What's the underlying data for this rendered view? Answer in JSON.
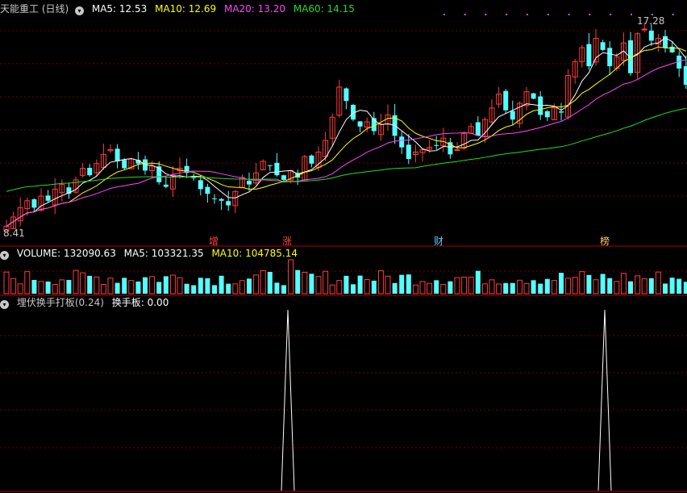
{
  "main": {
    "title": "天能重工 (日线)",
    "ma5": "MA5: 12.53",
    "ma10": "MA10: 12.69",
    "ma20": "MA20: 13.20",
    "ma60": "MA60: 14.15",
    "high_label": "17.28",
    "low_label": "8.41",
    "markers": [
      "增",
      "涨",
      "财",
      "榜"
    ]
  },
  "volume": {
    "label": "VOLUME: 132090.63",
    "ma5": "MA5: 103321.35",
    "ma10": "MA10: 104785.14"
  },
  "indicator": {
    "name": "埋伏换手打板(0.24)",
    "value": "换手板: 0.00"
  },
  "chart_data": {
    "type": "candlestick",
    "title": "天能重工 (日线)",
    "price_range": [
      8.41,
      17.28
    ],
    "close": [
      8.5,
      8.9,
      9.3,
      9.6,
      9.3,
      9.8,
      9.6,
      10.1,
      10.3,
      9.9,
      10.5,
      11.0,
      10.7,
      11.2,
      11.6,
      11.8,
      11.3,
      11.0,
      11.4,
      11.2,
      10.9,
      11.1,
      10.4,
      10.2,
      10.7,
      11.0,
      10.8,
      10.6,
      10.1,
      9.9,
      9.7,
      9.6,
      9.4,
      10.0,
      10.6,
      10.3,
      10.8,
      11.3,
      11.1,
      10.7,
      10.5,
      10.9,
      10.6,
      11.5,
      11.2,
      11.7,
      12.2,
      13.2,
      14.5,
      13.9,
      13.1,
      12.8,
      13.0,
      12.6,
      12.9,
      13.3,
      12.4,
      11.9,
      11.4,
      11.7,
      11.8,
      11.9,
      12.0,
      12.3,
      11.6,
      11.8,
      12.5,
      12.8,
      12.4,
      13.1,
      13.6,
      14.2,
      13.5,
      13.1,
      13.8,
      14.3,
      14.0,
      13.3,
      13.2,
      13.6,
      13.4,
      15.0,
      15.6,
      16.2,
      15.4,
      16.6,
      16.1,
      15.4,
      15.8,
      16.4,
      15.1,
      16.8,
      17.0,
      16.5,
      16.6,
      16.2,
      16.0,
      15.3,
      14.6
    ]
  }
}
